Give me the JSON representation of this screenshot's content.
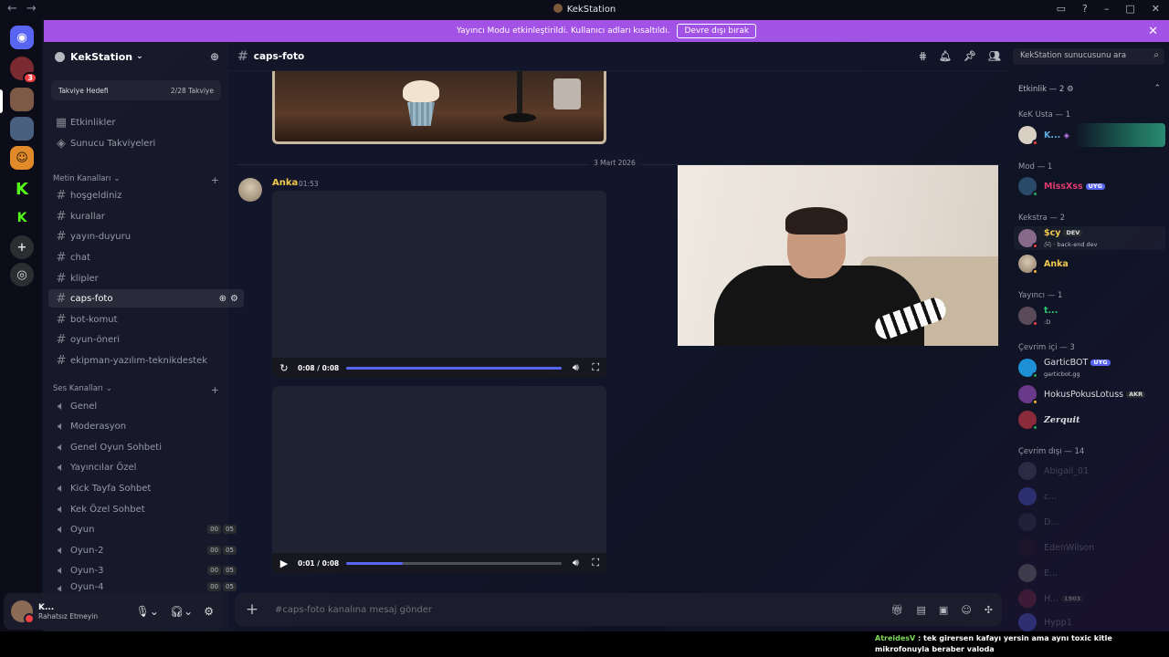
{
  "window": {
    "title": "KekStation"
  },
  "banner": {
    "text": "Yayıncı Modu etkinleştirildi. Kullanıcı adları kısaltıldı.",
    "button": "Devre dışı bırak"
  },
  "rail": {
    "badge": "3"
  },
  "server": {
    "name": "KekStation"
  },
  "boost": {
    "label": "Takviye Hedefi",
    "progress": "2/28 Takviye"
  },
  "top_links": [
    {
      "label": "Etkinlikler"
    },
    {
      "label": "Sunucu Takviyeleri"
    }
  ],
  "text_category": "Metin Kanalları",
  "text_channels": [
    {
      "label": "hoşgeldiniz"
    },
    {
      "label": "kurallar"
    },
    {
      "label": "yayın-duyuru"
    },
    {
      "label": "chat"
    },
    {
      "label": "klipler"
    },
    {
      "label": "caps-foto"
    },
    {
      "label": "bot-komut"
    },
    {
      "label": "oyun-öneri"
    },
    {
      "label": "ekipman-yazılım-teknikdestek"
    }
  ],
  "voice_category": "Ses Kanalları",
  "voice_channels": [
    {
      "label": "Genel"
    },
    {
      "label": "Moderasyon"
    },
    {
      "label": "Genel Oyun Sohbeti"
    },
    {
      "label": "Yayıncılar Özel"
    },
    {
      "label": "Kick Tayfa Sohbet"
    },
    {
      "label": "Kek Özel Sohbet"
    },
    {
      "label": "Oyun",
      "a": "00",
      "b": "05"
    },
    {
      "label": "Oyun-2",
      "a": "00",
      "b": "05"
    },
    {
      "label": "Oyun-3",
      "a": "00",
      "b": "05"
    },
    {
      "label": "Oyun-4",
      "a": "00",
      "b": "05"
    }
  ],
  "user": {
    "name": "K...",
    "status": "Rahatsız Etmeyin"
  },
  "channel": {
    "name": "caps-foto"
  },
  "search": {
    "placeholder": "KekStation sunucusunu ara"
  },
  "date_divider": "3 Mart 2026",
  "message": {
    "author": "Anka",
    "time": "01:53"
  },
  "videos": [
    {
      "time": "0:08 / 0:08",
      "progress": 1.0,
      "state": "ended"
    },
    {
      "time": "0:01 / 0:08",
      "progress": 0.26,
      "state": "paused"
    }
  ],
  "composer": {
    "placeholder": "#caps-foto kanalına mesaj gönder"
  },
  "members": {
    "activity": "Etkinlik — 2",
    "groups": [
      {
        "label": "KeK Usta — 1"
      },
      {
        "label": "Mod — 1"
      },
      {
        "label": "Kekstra — 2"
      },
      {
        "label": "Yayıncı — 1"
      },
      {
        "label": "Çevrim içi — 3"
      },
      {
        "label": "Çevrim dışı — 14"
      }
    ],
    "list": [
      {
        "name": "K...",
        "color": "#5dade2"
      },
      {
        "name": "MissXss",
        "tag": "UYG",
        "color": "#e03a6f"
      },
      {
        "name": "$cy",
        "tag": "DEV",
        "sub": "back-end dev",
        "color": "#f0c94c"
      },
      {
        "name": "Anka",
        "color": "#f0c94c"
      },
      {
        "name": "t...",
        "sub": ":D",
        "color": "#2ecc71"
      },
      {
        "name": "GarticBOT",
        "tag": "UYG",
        "sub": "garticbot.gg",
        "color": "#dbdee1"
      },
      {
        "name": "HokusPokusLotuss",
        "tag": "AKR",
        "color": "#dbdee1"
      },
      {
        "name": "Zerquit",
        "color": "#dbdee1"
      },
      {
        "name": "Abigail_01",
        "color": "#949ba4"
      },
      {
        "name": "c...",
        "color": "#949ba4"
      },
      {
        "name": "D...",
        "color": "#949ba4"
      },
      {
        "name": "EdenWilson",
        "color": "#949ba4"
      },
      {
        "name": "E...",
        "color": "#949ba4"
      },
      {
        "name": "H...",
        "tag": "1903",
        "color": "#949ba4"
      },
      {
        "name": "Hypp1",
        "color": "#949ba4"
      }
    ]
  },
  "ticker": {
    "user": "AtreidesV",
    "text": ": tek girersen kafayı yersin ama aynı toxic kitle mikrofonuyla beraber valoda"
  }
}
